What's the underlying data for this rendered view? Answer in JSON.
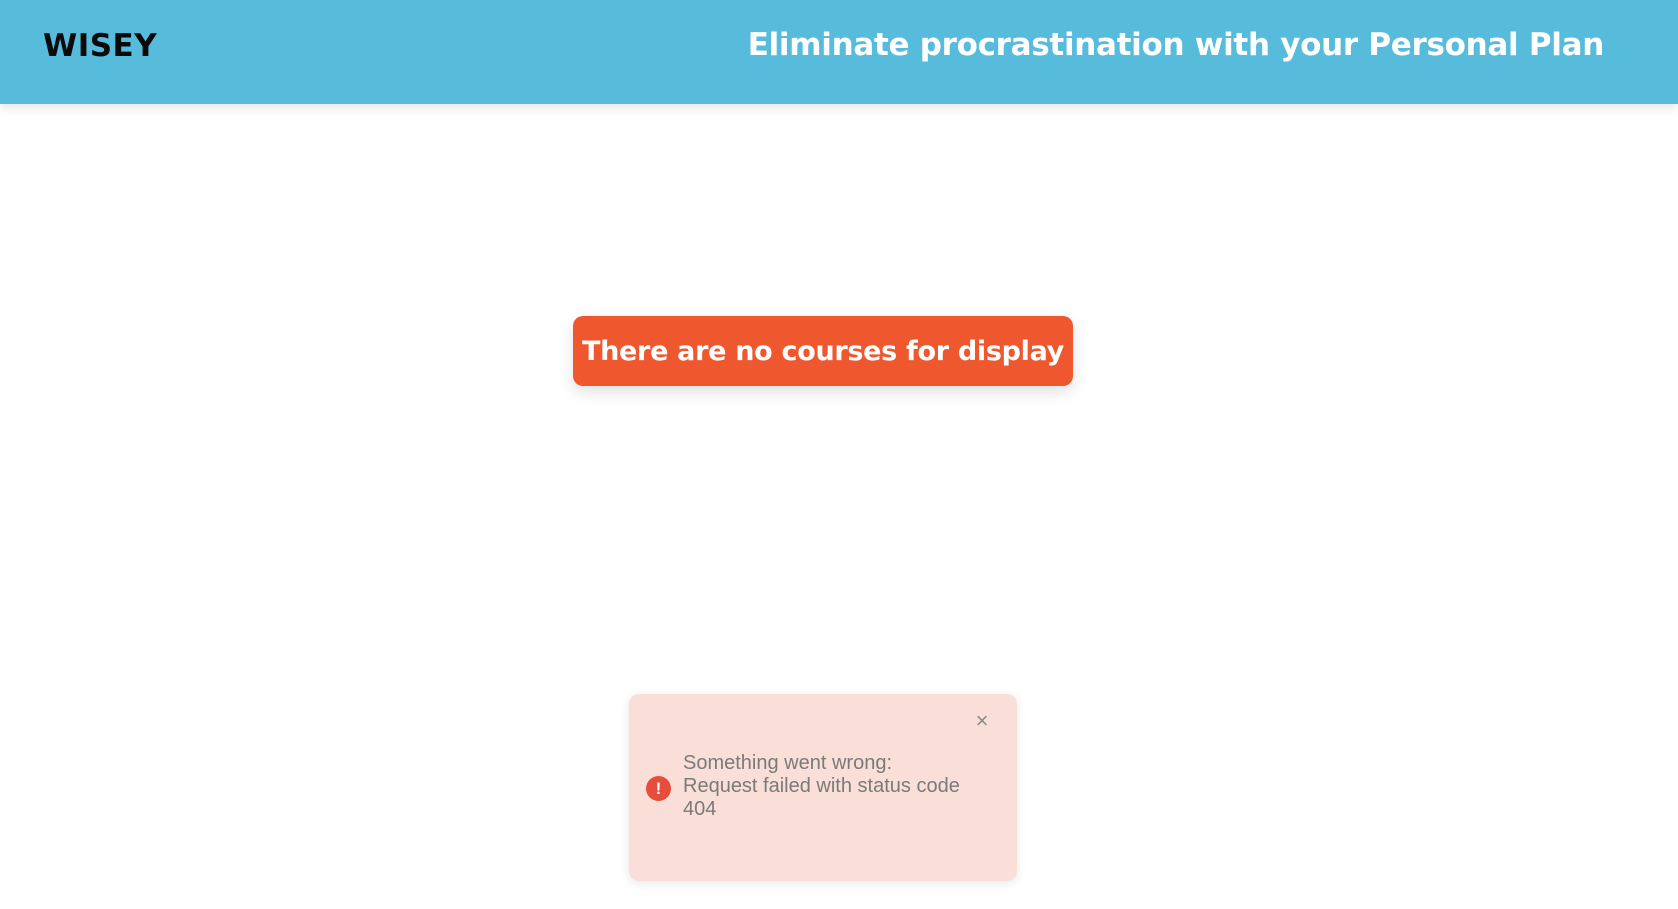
{
  "header": {
    "logo": "WISEY",
    "tagline": "Eliminate procrastination with your Personal Plan",
    "background_color": "#57bcdc"
  },
  "main": {
    "empty_message": "There are no courses for display",
    "empty_message_color": "#ef572e"
  },
  "toast": {
    "type": "error",
    "icon": "error-icon",
    "icon_glyph": "!",
    "close_icon": "close-icon",
    "close_glyph": "×",
    "line1": "Something went wrong:",
    "line2": "Request failed with status code",
    "line3": "404",
    "background_color": "#fadfd8"
  }
}
